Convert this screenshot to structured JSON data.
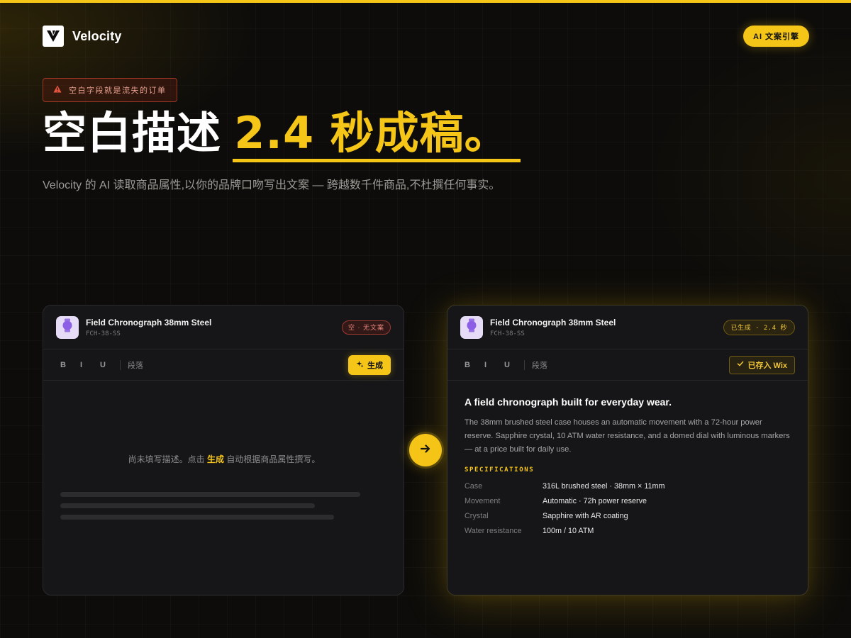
{
  "brand": {
    "name": "Velocity"
  },
  "header": {
    "ai_badge": "AI 文案引擎"
  },
  "hero": {
    "alert": "空白字段就是流失的订单",
    "title_main": "空白描述",
    "title_accent": "2.4 秒成稿。",
    "subtitle": "Velocity 的 AI 读取商品属性,以你的品牌口吻写出文案 — 跨越数千件商品,不杜撰任何事实。"
  },
  "toolbar": {
    "bold": "B",
    "italic": "I",
    "underline": "U",
    "paragraph": "段落"
  },
  "left_card": {
    "product_name": "Field Chronograph 38mm Steel",
    "sku": "FCH-38-SS",
    "status": "空 · 无文案",
    "generate_label": "生成",
    "empty_pre": "尚未填写描述。点击 ",
    "empty_highlight": "生成",
    "empty_post": " 自动根据商品属性撰写。"
  },
  "right_card": {
    "product_name": "Field Chronograph 38mm Steel",
    "sku": "FCH-38-SS",
    "status": "已生成 · 2.4 秒",
    "saved_label": "已存入 Wix",
    "copy_title": "A field chronograph built for everyday wear.",
    "copy_body": "The 38mm brushed steel case houses an automatic movement with a 72-hour power reserve. Sapphire crystal, 10 ATM water resistance, and a domed dial with luminous markers — at a price built for daily use.",
    "specs_heading": "SPECIFICATIONS",
    "specs": [
      {
        "label": "Case",
        "value": "316L brushed steel · 38mm × 11mm"
      },
      {
        "label": "Movement",
        "value": "Automatic · 72h power reserve"
      },
      {
        "label": "Crystal",
        "value": "Sapphire with AR coating"
      },
      {
        "label": "Water resistance",
        "value": "100m / 10 ATM"
      }
    ]
  },
  "colors": {
    "accent": "#f5c518",
    "background": "#0d0c0a",
    "card": "#161618",
    "danger": "#e5867a"
  },
  "icons": [
    "velocity-logo",
    "warning-icon",
    "watch-icon",
    "sparkle-icon",
    "check-icon",
    "arrow-right-icon"
  ]
}
